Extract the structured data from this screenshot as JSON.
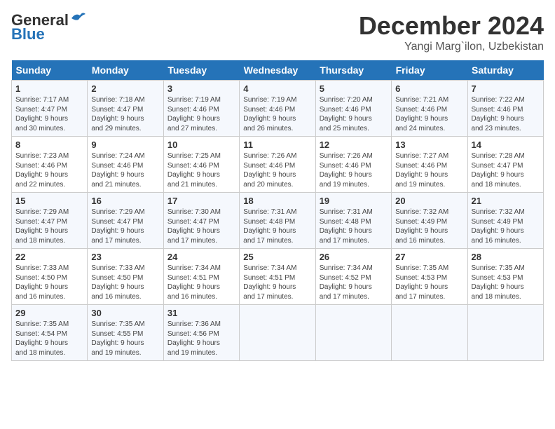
{
  "header": {
    "logo_general": "General",
    "logo_blue": "Blue",
    "month": "December 2024",
    "location": "Yangi Marg`ilon, Uzbekistan"
  },
  "columns": [
    "Sunday",
    "Monday",
    "Tuesday",
    "Wednesday",
    "Thursday",
    "Friday",
    "Saturday"
  ],
  "weeks": [
    [
      {
        "day": "1",
        "info": "Sunrise: 7:17 AM\nSunset: 4:47 PM\nDaylight: 9 hours\nand 30 minutes."
      },
      {
        "day": "2",
        "info": "Sunrise: 7:18 AM\nSunset: 4:47 PM\nDaylight: 9 hours\nand 29 minutes."
      },
      {
        "day": "3",
        "info": "Sunrise: 7:19 AM\nSunset: 4:46 PM\nDaylight: 9 hours\nand 27 minutes."
      },
      {
        "day": "4",
        "info": "Sunrise: 7:19 AM\nSunset: 4:46 PM\nDaylight: 9 hours\nand 26 minutes."
      },
      {
        "day": "5",
        "info": "Sunrise: 7:20 AM\nSunset: 4:46 PM\nDaylight: 9 hours\nand 25 minutes."
      },
      {
        "day": "6",
        "info": "Sunrise: 7:21 AM\nSunset: 4:46 PM\nDaylight: 9 hours\nand 24 minutes."
      },
      {
        "day": "7",
        "info": "Sunrise: 7:22 AM\nSunset: 4:46 PM\nDaylight: 9 hours\nand 23 minutes."
      }
    ],
    [
      {
        "day": "8",
        "info": "Sunrise: 7:23 AM\nSunset: 4:46 PM\nDaylight: 9 hours\nand 22 minutes."
      },
      {
        "day": "9",
        "info": "Sunrise: 7:24 AM\nSunset: 4:46 PM\nDaylight: 9 hours\nand 21 minutes."
      },
      {
        "day": "10",
        "info": "Sunrise: 7:25 AM\nSunset: 4:46 PM\nDaylight: 9 hours\nand 21 minutes."
      },
      {
        "day": "11",
        "info": "Sunrise: 7:26 AM\nSunset: 4:46 PM\nDaylight: 9 hours\nand 20 minutes."
      },
      {
        "day": "12",
        "info": "Sunrise: 7:26 AM\nSunset: 4:46 PM\nDaylight: 9 hours\nand 19 minutes."
      },
      {
        "day": "13",
        "info": "Sunrise: 7:27 AM\nSunset: 4:46 PM\nDaylight: 9 hours\nand 19 minutes."
      },
      {
        "day": "14",
        "info": "Sunrise: 7:28 AM\nSunset: 4:47 PM\nDaylight: 9 hours\nand 18 minutes."
      }
    ],
    [
      {
        "day": "15",
        "info": "Sunrise: 7:29 AM\nSunset: 4:47 PM\nDaylight: 9 hours\nand 18 minutes."
      },
      {
        "day": "16",
        "info": "Sunrise: 7:29 AM\nSunset: 4:47 PM\nDaylight: 9 hours\nand 17 minutes."
      },
      {
        "day": "17",
        "info": "Sunrise: 7:30 AM\nSunset: 4:47 PM\nDaylight: 9 hours\nand 17 minutes."
      },
      {
        "day": "18",
        "info": "Sunrise: 7:31 AM\nSunset: 4:48 PM\nDaylight: 9 hours\nand 17 minutes."
      },
      {
        "day": "19",
        "info": "Sunrise: 7:31 AM\nSunset: 4:48 PM\nDaylight: 9 hours\nand 17 minutes."
      },
      {
        "day": "20",
        "info": "Sunrise: 7:32 AM\nSunset: 4:49 PM\nDaylight: 9 hours\nand 16 minutes."
      },
      {
        "day": "21",
        "info": "Sunrise: 7:32 AM\nSunset: 4:49 PM\nDaylight: 9 hours\nand 16 minutes."
      }
    ],
    [
      {
        "day": "22",
        "info": "Sunrise: 7:33 AM\nSunset: 4:50 PM\nDaylight: 9 hours\nand 16 minutes."
      },
      {
        "day": "23",
        "info": "Sunrise: 7:33 AM\nSunset: 4:50 PM\nDaylight: 9 hours\nand 16 minutes."
      },
      {
        "day": "24",
        "info": "Sunrise: 7:34 AM\nSunset: 4:51 PM\nDaylight: 9 hours\nand 16 minutes."
      },
      {
        "day": "25",
        "info": "Sunrise: 7:34 AM\nSunset: 4:51 PM\nDaylight: 9 hours\nand 17 minutes."
      },
      {
        "day": "26",
        "info": "Sunrise: 7:34 AM\nSunset: 4:52 PM\nDaylight: 9 hours\nand 17 minutes."
      },
      {
        "day": "27",
        "info": "Sunrise: 7:35 AM\nSunset: 4:53 PM\nDaylight: 9 hours\nand 17 minutes."
      },
      {
        "day": "28",
        "info": "Sunrise: 7:35 AM\nSunset: 4:53 PM\nDaylight: 9 hours\nand 18 minutes."
      }
    ],
    [
      {
        "day": "29",
        "info": "Sunrise: 7:35 AM\nSunset: 4:54 PM\nDaylight: 9 hours\nand 18 minutes."
      },
      {
        "day": "30",
        "info": "Sunrise: 7:35 AM\nSunset: 4:55 PM\nDaylight: 9 hours\nand 19 minutes."
      },
      {
        "day": "31",
        "info": "Sunrise: 7:36 AM\nSunset: 4:56 PM\nDaylight: 9 hours\nand 19 minutes."
      },
      null,
      null,
      null,
      null
    ]
  ]
}
